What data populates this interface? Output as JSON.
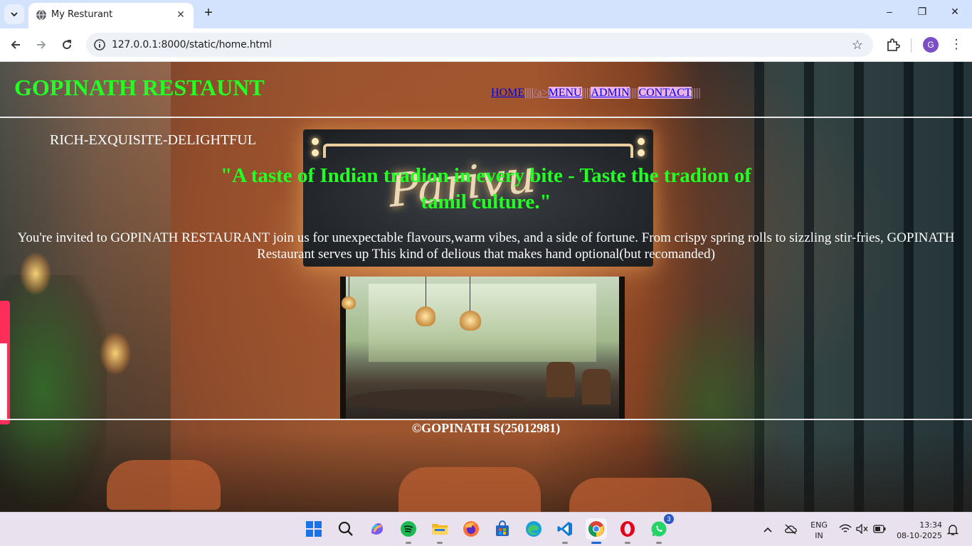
{
  "browser": {
    "tab_title": "My Resturant",
    "url": "127.0.0.1:8000/static/home.html",
    "profile_initial": "G"
  },
  "page": {
    "site_title": "GOPINATH RESTAUNT",
    "nav": {
      "home": "HOME",
      "bars1": "||||",
      "stray": "/a>",
      "menu": "MENU",
      "bars2": "||||",
      "admin": "ADMIN",
      "bars3": "||||",
      "contact": "CONTACT",
      "bars4": "||||"
    },
    "tagline": "RICH-EXQUISITE-DELIGHTFUL",
    "quote": "\"A taste of Indian tradion in every bite - Taste the tradion of tamil culture.\"",
    "invite": "You're invited to GOPINATH RESTAURANT join us for unexpectable flavours,warm vibes, and a side of fortune. From crispy spring rolls to sizzling stir-fries, GOPINATH Restaurant serves up This kind of delious that makes hand optional(but recomanded)",
    "sign_text": "Parivu",
    "footer": "©GOPINATH S(25012981)"
  },
  "taskbar": {
    "apps": [
      "start-icon",
      "search-icon",
      "copilot-icon",
      "spotify-icon",
      "file-explorer-icon",
      "firefox-icon",
      "store-icon",
      "edge-icon",
      "vscode-icon",
      "chrome-icon",
      "opera-icon",
      "whatsapp-icon"
    ],
    "whatsapp_badge": "3",
    "lang_line1": "ENG",
    "lang_line2": "IN",
    "time": "13:34",
    "date": "08-10-2025"
  },
  "colors": {
    "title_green": "#22ff22",
    "nav_link": "#0000ee",
    "nav_highlight": "#fabefa"
  }
}
